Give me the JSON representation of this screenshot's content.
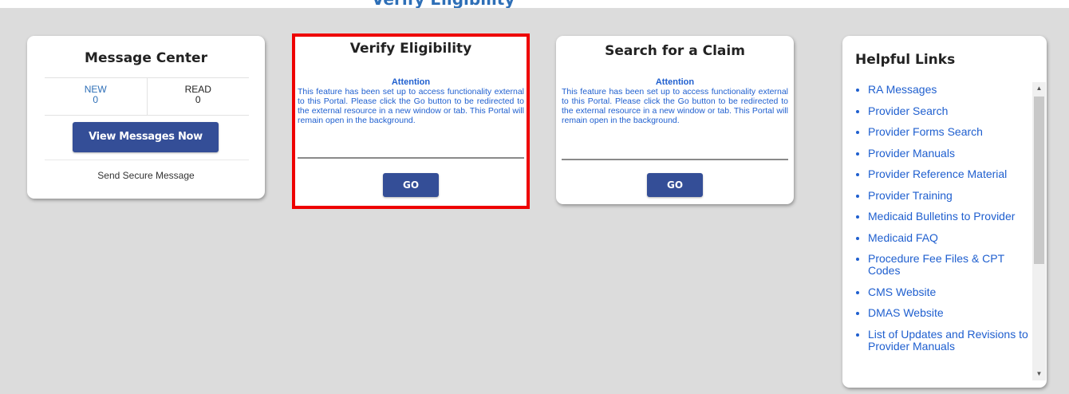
{
  "header": {
    "cut_title": "Verify Eligibility"
  },
  "message_center": {
    "title": "Message Center",
    "new_label": "NEW",
    "new_count": "0",
    "read_label": "READ",
    "read_count": "0",
    "view_button": "View Messages Now",
    "send_link": "Send Secure Message"
  },
  "verify": {
    "title": "Verify Eligibility",
    "attention": "Attention",
    "description": "This feature has been set up to access functionality external to this Portal. Please click the Go button to be redirected to the external resource in a new window or tab. This Portal will remain open in the background.",
    "go_button": "GO"
  },
  "search": {
    "title": "Search for a Claim",
    "attention": "Attention",
    "description": "This feature has been set up to access functionality external to this Portal. Please click the Go button to be redirected to the external resource in a new window or tab. This Portal will remain open in the background.",
    "go_button": "GO"
  },
  "helpful_links": {
    "title": "Helpful Links",
    "items": [
      "RA Messages",
      "Provider Search",
      "Provider Forms Search",
      "Provider Manuals",
      "Provider Reference Material",
      "Provider Training",
      "Medicaid Bulletins to Provider",
      "Medicaid FAQ",
      "Procedure Fee Files & CPT Codes",
      "CMS Website",
      "DMAS Website",
      "List of Updates and Revisions to Provider Manuals"
    ]
  },
  "colors": {
    "accent": "#344e97",
    "link": "#1f5fcf",
    "highlight": "#ee0000",
    "background": "#dcdcdc"
  }
}
